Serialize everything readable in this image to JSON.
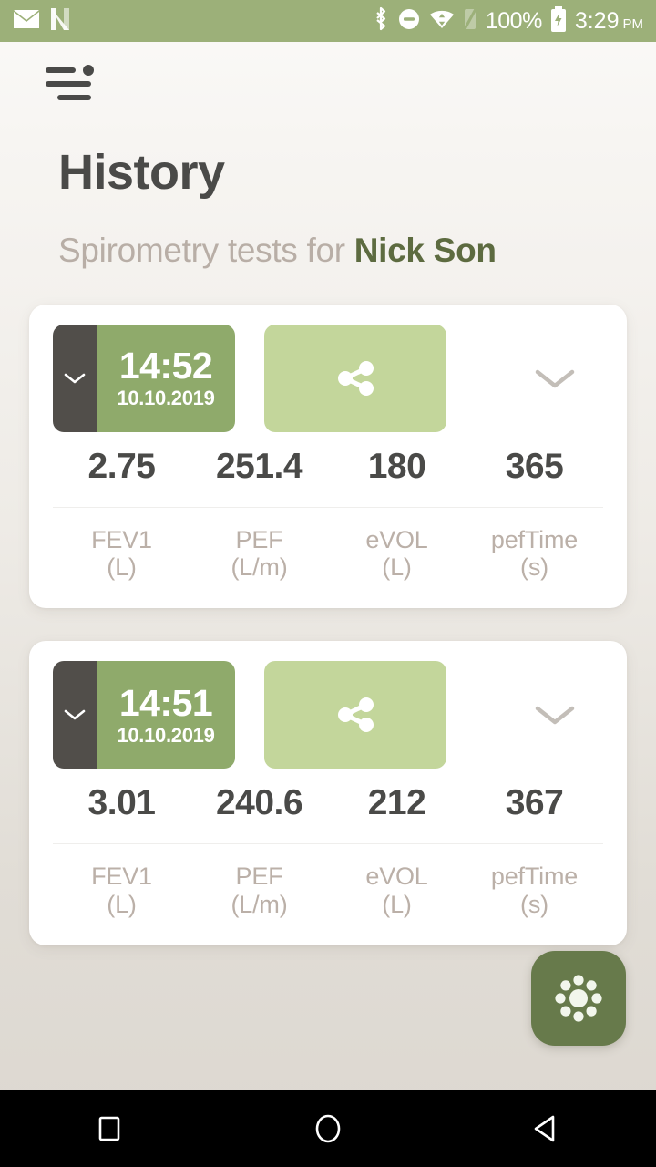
{
  "status_bar": {
    "background": "#9cb079",
    "left_icons": [
      "mail-icon",
      "netflix-n-icon"
    ],
    "right_icons": [
      "bluetooth-icon",
      "do-not-disturb-icon",
      "wifi-icon",
      "signal-off-icon"
    ],
    "battery_percent": "100%",
    "battery_icon": "battery-charging-icon",
    "time": "3:29",
    "time_period": "PM"
  },
  "app_bar": {
    "menu_icon": "hamburger-menu-icon"
  },
  "header": {
    "title": "History",
    "subtitle_prefix": "Spirometry tests for",
    "subtitle_name": "Nick Son",
    "name_color": "#5d6b40"
  },
  "metric_labels": [
    {
      "name": "FEV1",
      "unit": "(L)"
    },
    {
      "name": "PEF",
      "unit": "(L/m)"
    },
    {
      "name": "eVOL",
      "unit": "(L)"
    },
    {
      "name": "pefTime",
      "unit": "(s)"
    }
  ],
  "cards": [
    {
      "time": "14:52",
      "date": "10.10.2019",
      "share_icon": "share-icon",
      "collapse_icon": "chevron-down-icon",
      "expand_icon": "chevron-down-icon",
      "values": [
        "2.75",
        "251.4",
        "180",
        "365"
      ]
    },
    {
      "time": "14:51",
      "date": "10.10.2019",
      "share_icon": "share-icon",
      "collapse_icon": "chevron-down-icon",
      "expand_icon": "chevron-down-icon",
      "values": [
        "3.01",
        "240.6",
        "212",
        "367"
      ]
    }
  ],
  "fab": {
    "icon": "radial-dots-icon",
    "color": "#677a4b"
  },
  "nav_bar": {
    "buttons": [
      "recents-square-icon",
      "home-circle-icon",
      "back-triangle-icon"
    ]
  }
}
